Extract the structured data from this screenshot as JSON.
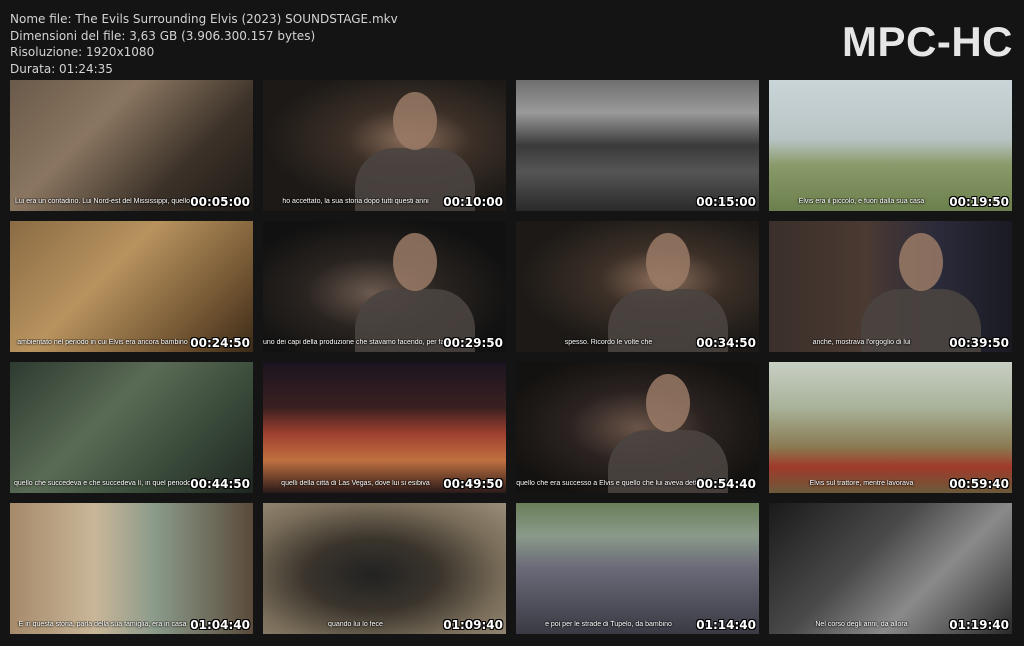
{
  "file_info": {
    "name": "Nome file: The Evils Surrounding Elvis (2023) SOUNDSTAGE.mkv",
    "size": "Dimensioni del file: 3,63 GB (3.906.300.157 bytes)",
    "resolution": "Risoluzione: 1920x1080",
    "duration": "Durata: 01:24:35"
  },
  "brand": "MPC-HC",
  "thumbnails": [
    {
      "time": "00:05:00",
      "subtitle": "Lui era un contadino. Lui Nord-est del Mississippi, quello",
      "scene": "hands"
    },
    {
      "time": "00:10:00",
      "subtitle": "ho accettato, la sua storia dopo tutti questi anni",
      "scene": "interview-man-gray"
    },
    {
      "time": "00:15:00",
      "subtitle": "",
      "scene": "grave"
    },
    {
      "time": "00:19:50",
      "subtitle": "Elvis era il piccolo, e fuori dalla sua casa",
      "scene": "truck-boy"
    },
    {
      "time": "00:24:50",
      "subtitle": "ambientato nel periodo in cui Elvis era ancora bambino",
      "scene": "sepia-hands"
    },
    {
      "time": "00:29:50",
      "subtitle": "uno dei capi della produzione che stavamo facendo, per fare",
      "scene": "interview-glasses"
    },
    {
      "time": "00:34:50",
      "subtitle": "spesso. Ricordo le volte che",
      "scene": "interview-man-gray"
    },
    {
      "time": "00:39:50",
      "subtitle": "anche, mostrava l'orgoglio di lui",
      "scene": "interview-sweater"
    },
    {
      "time": "00:44:50",
      "subtitle": "quello che succedeva e che succedeva lì, in quel periodo",
      "scene": "green-blur"
    },
    {
      "time": "00:49:50",
      "subtitle": "quelli della città di Las Vegas, dove lui si esibiva",
      "scene": "vegas"
    },
    {
      "time": "00:54:40",
      "subtitle": "quello che era successo a Elvis e quello che lui aveva detto",
      "scene": "interview-vest"
    },
    {
      "time": "00:59:40",
      "subtitle": "Elvis sul trattore, mentre lavorava",
      "scene": "tractor"
    },
    {
      "time": "01:04:40",
      "subtitle": "E in questa storia, parla della sua famiglia, era in casa",
      "scene": "kitchen"
    },
    {
      "time": "01:09:40",
      "subtitle": "quando lui lo fece",
      "scene": "record"
    },
    {
      "time": "01:14:40",
      "subtitle": "e poi per le strade di Tupelo, da bambino",
      "scene": "crowd"
    },
    {
      "time": "01:19:40",
      "subtitle": "Nel corso degli anni, da allora",
      "scene": "elvis-bw"
    }
  ]
}
